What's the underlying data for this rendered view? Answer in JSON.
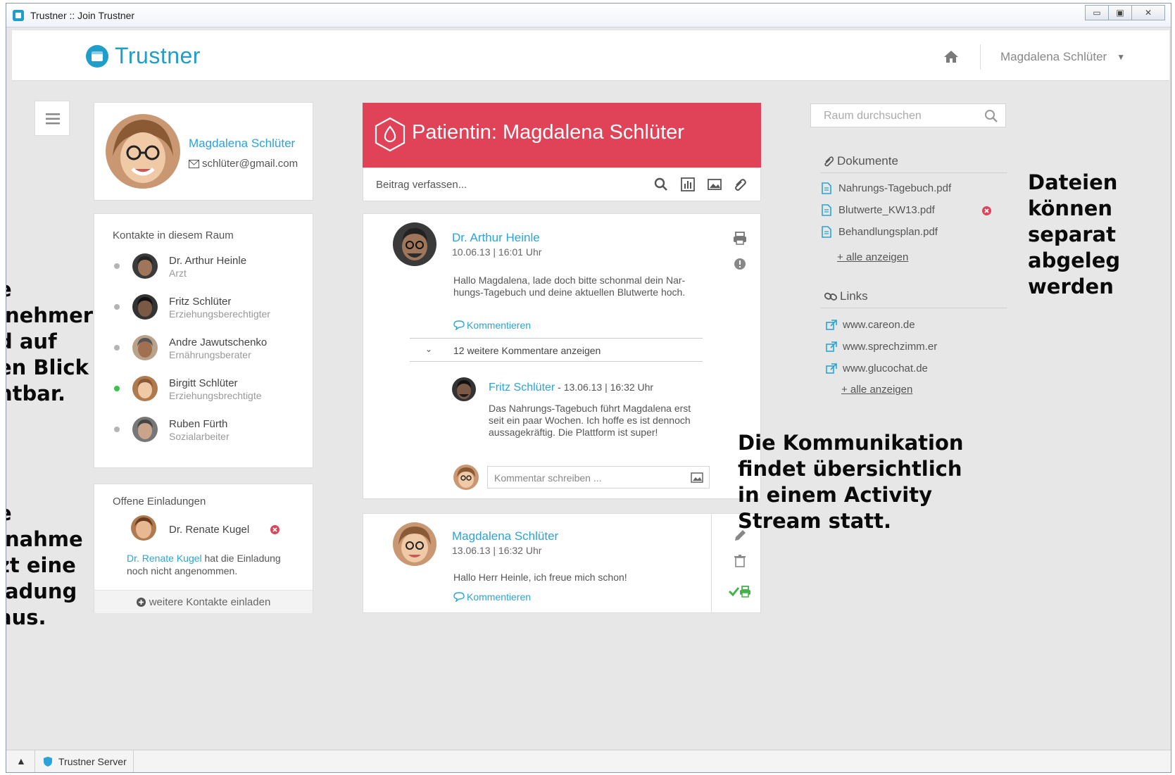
{
  "window": {
    "title": "Trustner :: Join Trustner"
  },
  "header": {
    "brand": "Trustner",
    "user_name": "Magdalena Schlüter"
  },
  "profile": {
    "name": "Magdalena Schlüter",
    "email": "schlüter@gmail.com"
  },
  "contacts": {
    "title": "Kontakte in diesem Raum",
    "items": [
      {
        "name": "Dr. Arthur Heinle",
        "role": "Arzt",
        "online": false
      },
      {
        "name": "Fritz Schlüter",
        "role": "Erziehungsberechtigter",
        "online": false
      },
      {
        "name": "Andre Jawutschenko",
        "role": "Ernährungsberater",
        "online": false
      },
      {
        "name": "Birgitt Schlüter",
        "role": "Erziehungsbrechtigte",
        "online": true
      },
      {
        "name": "Ruben Fürth",
        "role": "Sozialarbeiter",
        "online": false
      }
    ]
  },
  "invitations": {
    "title": "Offene Einladungen",
    "invitee": "Dr. Renate Kugel",
    "note_name": "Dr. Renate Kugel",
    "note_text1": " hat die Einladung",
    "note_text2": "noch nicht angenommen.",
    "invite_more": "weitere Kontakte einladen"
  },
  "room": {
    "title": "Patientin: Magdalena Schlüter",
    "compose_placeholder": "Beitrag verfassen..."
  },
  "post1": {
    "author": "Dr. Arthur Heinle",
    "time": "10.06.13 | 16:01 Uhr",
    "text1": "Hallo Magdalena, lade doch bitte schonmal dein Nar-",
    "text2": "hungs-Tagebuch und deine aktuellen Blutwerte hoch.",
    "comment_label": "Kommentieren",
    "more_comments": "12 weitere Kommentare anzeigen",
    "reply_author": "Fritz Schlüter",
    "reply_time": " - 13.06.13 | 16:32 Uhr",
    "reply_text1": "Das Nahrungs-Tagebuch führt Magdalena erst",
    "reply_text2": "seit ein paar Wochen. Ich hoffe es ist dennoch",
    "reply_text3": "aussagekräftig. Die Plattform ist super!",
    "comment_placeholder": "Kommentar schreiben ..."
  },
  "post2": {
    "author": "Magdalena Schlüter",
    "time": "13.06.13 | 16:32 Uhr",
    "text": "Hallo Herr Heinle, ich freue mich schon!",
    "comment_label": "Kommentieren"
  },
  "right": {
    "search_placeholder": "Raum durchsuchen",
    "docs_title": "Dokumente",
    "docs": [
      "Nahrungs-Tagebuch.pdf",
      "Blutwerte_KW13.pdf",
      "Behandlungsplan.pdf"
    ],
    "docs_more": "+ alle anzeigen",
    "links_title": "Links",
    "links": [
      "www.careon.de",
      "www.sprechzimm.er",
      "www.glucochat.de"
    ],
    "links_more": "+ alle anzeigen"
  },
  "annotations": {
    "left1": [
      "e",
      "lnehmer",
      "d auf",
      "en Blick",
      "ntbar."
    ],
    "left2": [
      "e",
      "lnahme",
      "zt eine",
      "ladung",
      "aus."
    ],
    "middle": [
      "Die Kommunikation",
      "findet übersichtlich",
      "in einem Activity",
      "Stream statt."
    ],
    "right": [
      "Dateien",
      "können",
      "separat",
      "abgeleg",
      "werden"
    ]
  },
  "taskbar": {
    "label": "Trustner Server"
  },
  "colors": {
    "accent": "#e04358",
    "link": "#2aa4d8",
    "brand": "#1e9ec9"
  }
}
